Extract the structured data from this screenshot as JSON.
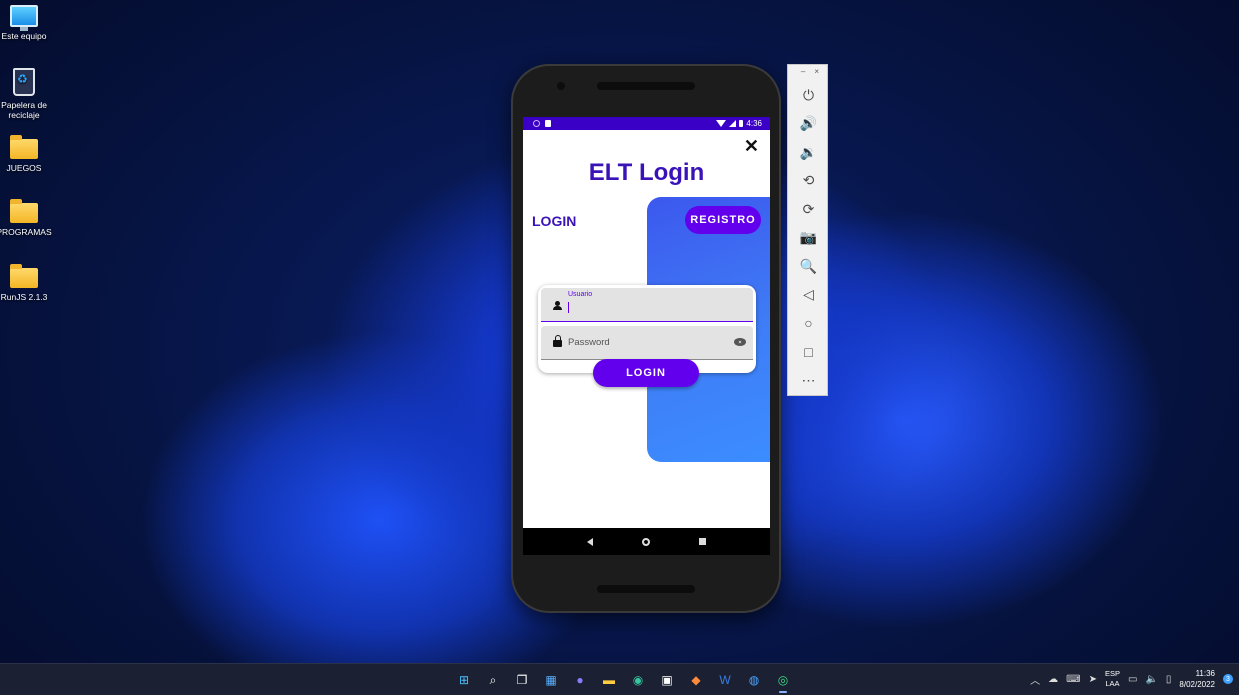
{
  "desktop": {
    "icons": [
      {
        "label": "Este equipo",
        "icon": "computer-icon"
      },
      {
        "label": "Papelera de reciclaje",
        "icon": "recycle-bin-icon"
      },
      {
        "label": "JUEGOS",
        "icon": "folder-icon"
      },
      {
        "label": "PROGRAMAS",
        "icon": "folder-icon"
      },
      {
        "label": "RunJS 2.1.3",
        "icon": "folder-icon"
      }
    ]
  },
  "emulator": {
    "status_time": "4:36",
    "app": {
      "title": "ELT Login",
      "close_glyph": "✕",
      "tab_login": "LOGIN",
      "registro_button": "REGISTRO",
      "username_label": "Usuario",
      "password_placeholder": "Password",
      "login_button": "LOGIN"
    },
    "side_panel": {
      "minimize": "–",
      "close": "×",
      "buttons": [
        "power-icon",
        "volume-up-icon",
        "volume-down-icon",
        "rotate-left-icon",
        "rotate-right-icon",
        "camera-icon",
        "zoom-icon",
        "back-icon",
        "home-icon",
        "overview-icon",
        "more-icon"
      ]
    }
  },
  "taskbar": {
    "apps": [
      "start-icon",
      "search-icon",
      "task-view-icon",
      "widgets-icon",
      "chat-icon",
      "file-explorer-icon",
      "edge-icon",
      "store-icon",
      "git-icon",
      "word-icon",
      "app-icon",
      "android-studio-icon"
    ],
    "language": "ESP",
    "language_sub": "LAA",
    "time": "11:36",
    "date": "8/02/2022",
    "notifications": "3"
  },
  "colors": {
    "accent": "#6200ee",
    "status_bar": "#3b00c6",
    "title": "#3a13b8",
    "blue_panel": "#3f7df6"
  }
}
